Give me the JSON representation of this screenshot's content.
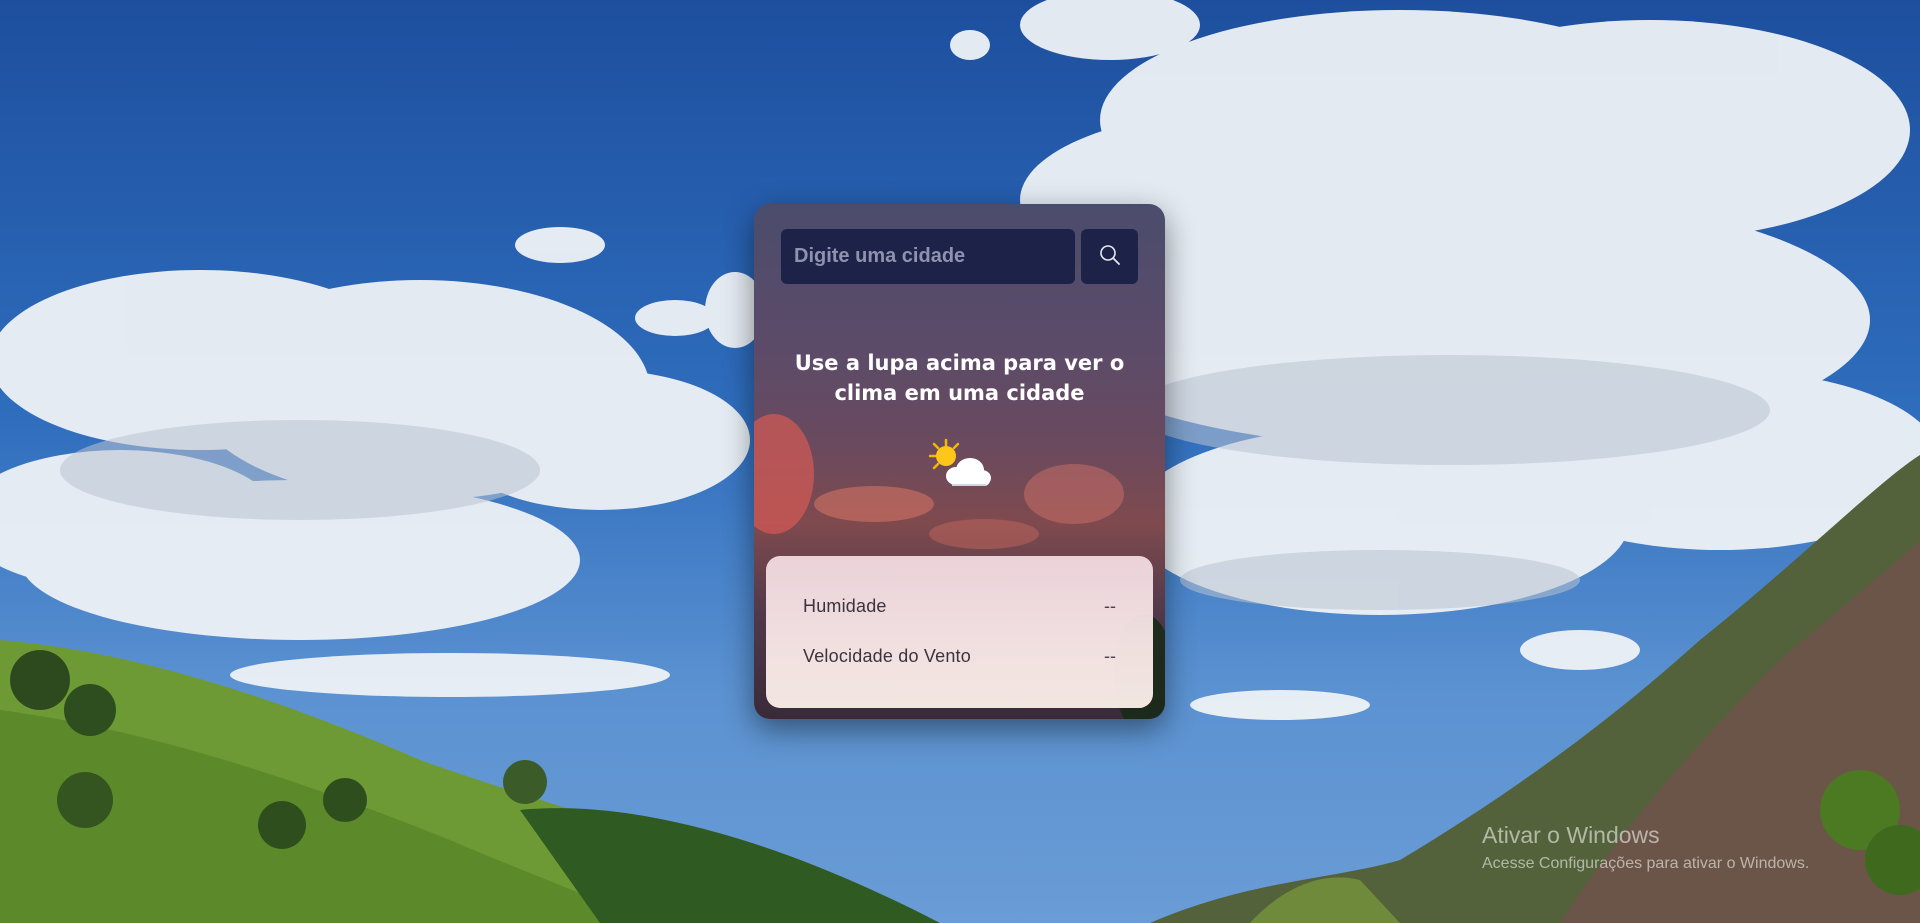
{
  "search": {
    "placeholder": "Digite uma cidade",
    "button_icon": "search-icon"
  },
  "main": {
    "headline": "Use a lupa acima para ver o clima em uma cidade",
    "weather_icon": "sun-behind-cloud-icon"
  },
  "details": {
    "rows": [
      {
        "label": "Humidade",
        "value": "--"
      },
      {
        "label": "Velocidade do Vento",
        "value": "--"
      }
    ]
  },
  "watermark": {
    "title": "Ativar o Windows",
    "subtitle": "Acesse Configurações para ativar o Windows."
  },
  "colors": {
    "input_bg": "#1c2248",
    "card_panel": "#f6e4e6"
  }
}
